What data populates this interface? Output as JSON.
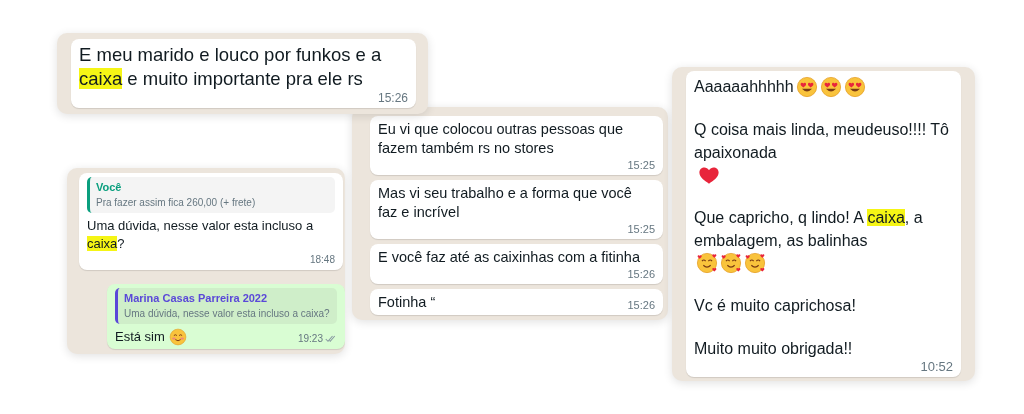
{
  "chats": [
    {
      "messages": [
        {
          "outgoing": false,
          "paragraphs": [
            [
              {
                "kind": "text",
                "text": "E meu marido e louco por funkos e a "
              },
              {
                "kind": "highlight",
                "text": "caixa"
              },
              {
                "kind": "text",
                "text": " e muito importante pra ele rs"
              }
            ]
          ],
          "time": "15:26"
        }
      ]
    },
    {
      "messages": [
        {
          "outgoing": false,
          "paragraphs": [
            [
              {
                "kind": "text",
                "text": "Eu vi que colocou outras pessoas que fazem também rs no stores"
              }
            ]
          ],
          "time": "15:25"
        },
        {
          "outgoing": false,
          "paragraphs": [
            [
              {
                "kind": "text",
                "text": "Mas vi seu trabalho e a forma que você faz e incrível"
              }
            ]
          ],
          "time": "15:25"
        },
        {
          "outgoing": false,
          "paragraphs": [
            [
              {
                "kind": "text",
                "text": "E você faz até as caixinhas com a fitinha"
              }
            ]
          ],
          "time": "15:26"
        },
        {
          "outgoing": false,
          "paragraphs": [
            [
              {
                "kind": "text",
                "text": "Fotinha “"
              }
            ]
          ],
          "time": "15:26"
        }
      ]
    },
    {
      "messages": [
        {
          "outgoing": false,
          "quote": {
            "author": "Você",
            "text": "Pra fazer assim fica 260,00 (+ frete)",
            "color": "#0a9f7e"
          },
          "paragraphs": [
            [
              {
                "kind": "text",
                "text": "Uma dúvida, nesse valor esta incluso a "
              },
              {
                "kind": "highlight",
                "text": "caixa"
              },
              {
                "kind": "text",
                "text": "?"
              }
            ]
          ],
          "time": "18:48"
        },
        {
          "outgoing": true,
          "quote": {
            "author": "Marina Casas Parreira 2022",
            "text": "Uma dúvida, nesse valor esta incluso a caixa?",
            "color": "#5a48d8"
          },
          "paragraphs": [
            [
              {
                "kind": "text",
                "text": "Está sim"
              },
              {
                "kind": "blush"
              }
            ]
          ],
          "time": "19:23"
        }
      ]
    },
    {
      "messages": [
        {
          "outgoing": false,
          "paragraphs": [
            [
              {
                "kind": "text",
                "text": "Aaaaaahhhhh"
              },
              {
                "kind": "heart-eyes"
              },
              {
                "kind": "heart-eyes"
              },
              {
                "kind": "heart-eyes"
              }
            ],
            [
              {
                "kind": "text",
                "text": "Q coisa mais linda, meudeuso!!!! Tô apaixonada"
              },
              {
                "kind": "heart"
              }
            ],
            [
              {
                "kind": "text",
                "text": "Que capricho, q lindo! A "
              },
              {
                "kind": "highlight",
                "text": "caixa"
              },
              {
                "kind": "text",
                "text": ", a embalagem, as balinhas"
              },
              {
                "kind": "smiling-hearts"
              },
              {
                "kind": "smiling-hearts"
              },
              {
                "kind": "smiling-hearts"
              }
            ],
            [
              {
                "kind": "text",
                "text": "Vc é muito caprichosa!"
              }
            ],
            [
              {
                "kind": "text",
                "text": "Muito muito obrigada!!"
              }
            ]
          ],
          "time": "10:52"
        }
      ]
    }
  ]
}
